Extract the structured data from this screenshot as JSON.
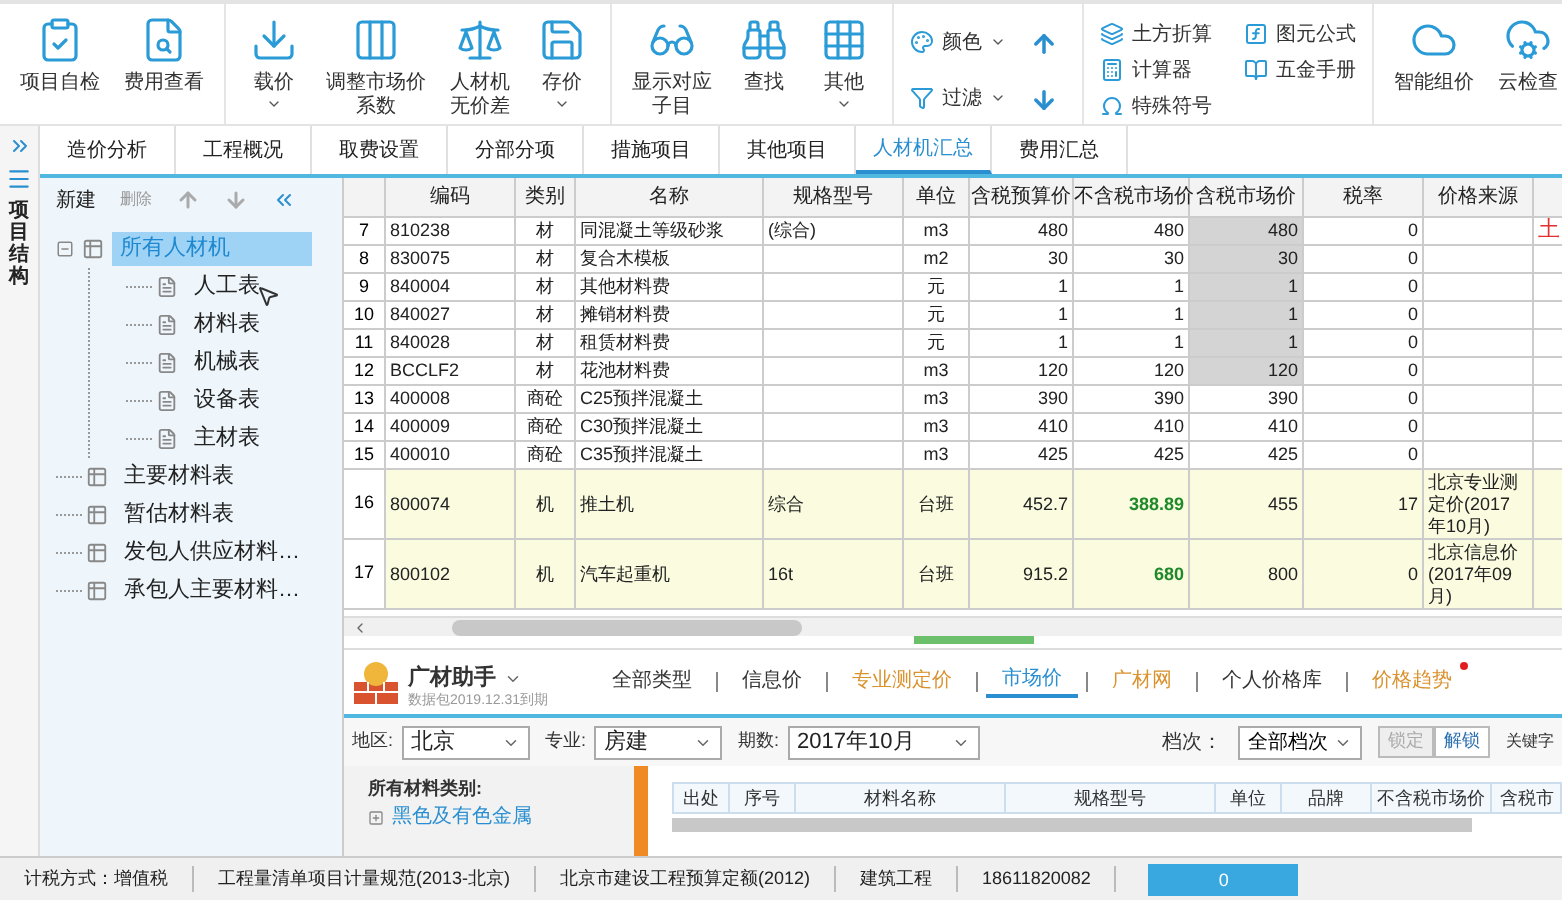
{
  "toolbar": {
    "groups": [
      {
        "kind": "big",
        "items": [
          {
            "lines": [
              "项目自检"
            ],
            "dropdown": false
          },
          {
            "lines": [
              "费用查看"
            ],
            "dropdown": false
          }
        ]
      },
      {
        "kind": "big",
        "items": [
          {
            "lines": [
              "载价"
            ],
            "dropdown": true
          },
          {
            "lines": [
              "调整市场价",
              "系数"
            ],
            "dropdown": false
          },
          {
            "lines": [
              "人材机",
              "无价差"
            ],
            "dropdown": false
          },
          {
            "lines": [
              "存价"
            ],
            "dropdown": true
          }
        ]
      },
      {
        "kind": "big",
        "items": [
          {
            "lines": [
              "显示对应",
              "子目"
            ],
            "dropdown": false
          },
          {
            "lines": [
              "查找"
            ],
            "dropdown": false
          },
          {
            "lines": [
              "其他"
            ],
            "dropdown": true
          }
        ]
      },
      {
        "kind": "compact",
        "items": [
          {
            "kind": "text",
            "label": "颜色",
            "dropdown": true
          },
          {
            "kind": "text",
            "label": "过滤",
            "dropdown": true
          },
          {
            "kind": "arrow-up"
          },
          {
            "kind": "arrow-down"
          }
        ]
      },
      {
        "kind": "list",
        "items": [
          {
            "kind": "text",
            "label": "土方折算",
            "dropdown": false
          },
          {
            "kind": "text",
            "label": "计算器",
            "dropdown": false
          },
          {
            "kind": "text",
            "label": "特殊符号",
            "dropdown": false
          },
          {
            "kind": "text",
            "label": "图元公式",
            "dropdown": false
          },
          {
            "kind": "text",
            "label": "五金手册",
            "dropdown": false
          }
        ]
      },
      {
        "kind": "big",
        "items": [
          {
            "lines": [
              "智能组价"
            ],
            "dropdown": false
          },
          {
            "lines": [
              "云检查"
            ],
            "dropdown": false
          }
        ]
      }
    ]
  },
  "side_strip": {
    "label": "项目结构"
  },
  "tabs": [
    {
      "label": "造价分析",
      "selected": false
    },
    {
      "label": "工程概况",
      "selected": false
    },
    {
      "label": "取费设置",
      "selected": false
    },
    {
      "label": "分部分项",
      "selected": false
    },
    {
      "label": "措施项目",
      "selected": false
    },
    {
      "label": "其他项目",
      "selected": false
    },
    {
      "label": "人材机汇总",
      "selected": true
    },
    {
      "label": "费用汇总",
      "selected": false
    }
  ],
  "tree_toolbar": {
    "new": "新建",
    "delete": "删除",
    "delete_disabled": true
  },
  "tree": [
    {
      "label": "所有人材机",
      "kind": "group",
      "selected": true,
      "expanded": true,
      "children": [
        {
          "label": "人工表",
          "kind": "sheet",
          "selected": false
        },
        {
          "label": "材料表",
          "kind": "sheet",
          "selected": false
        },
        {
          "label": "机械表",
          "kind": "sheet",
          "selected": false
        },
        {
          "label": "设备表",
          "kind": "sheet",
          "selected": false
        },
        {
          "label": "主材表",
          "kind": "sheet",
          "selected": false
        }
      ]
    },
    {
      "label": "主要材料表",
      "kind": "group",
      "selected": false
    },
    {
      "label": "暂估材料表",
      "kind": "group",
      "selected": false
    },
    {
      "label": "发包人供应材料…",
      "kind": "group",
      "selected": false
    },
    {
      "label": "承包人主要材料…",
      "kind": "group",
      "selected": false
    }
  ],
  "table": {
    "columns": [
      "编码",
      "类别",
      "名称",
      "规格型号",
      "单位",
      "含税预算价",
      "不含税市场价",
      "含税市场价",
      "税率",
      "价格来源"
    ],
    "rows": [
      {
        "no": "7",
        "cells": [
          "810238",
          "材",
          "同混凝土等级砂浆",
          "(综合)",
          "m3",
          "480",
          "480",
          "480",
          "0",
          ""
        ],
        "shaded": true,
        "highlighted": false,
        "note": "土"
      },
      {
        "no": "8",
        "cells": [
          "830075",
          "材",
          "复合木模板",
          "",
          "m2",
          "30",
          "30",
          "30",
          "0",
          ""
        ],
        "shaded": true,
        "highlighted": false
      },
      {
        "no": "9",
        "cells": [
          "840004",
          "材",
          "其他材料费",
          "",
          "元",
          "1",
          "1",
          "1",
          "0",
          ""
        ],
        "shaded": true,
        "highlighted": false
      },
      {
        "no": "10",
        "cells": [
          "840027",
          "材",
          "摊销材料费",
          "",
          "元",
          "1",
          "1",
          "1",
          "0",
          ""
        ],
        "shaded": true,
        "highlighted": false
      },
      {
        "no": "11",
        "cells": [
          "840028",
          "材",
          "租赁材料费",
          "",
          "元",
          "1",
          "1",
          "1",
          "0",
          ""
        ],
        "shaded": true,
        "highlighted": false
      },
      {
        "no": "12",
        "cells": [
          "BCCLF2",
          "材",
          "花池材料费",
          "",
          "m3",
          "120",
          "120",
          "120",
          "0",
          ""
        ],
        "shaded": true,
        "highlighted": false
      },
      {
        "no": "13",
        "cells": [
          "400008",
          "商砼",
          "C25预拌混凝土",
          "",
          "m3",
          "390",
          "390",
          "390",
          "0",
          ""
        ],
        "shaded": false,
        "highlighted": false
      },
      {
        "no": "14",
        "cells": [
          "400009",
          "商砼",
          "C30预拌混凝土",
          "",
          "m3",
          "410",
          "410",
          "410",
          "0",
          ""
        ],
        "shaded": false,
        "highlighted": false
      },
      {
        "no": "15",
        "cells": [
          "400010",
          "商砼",
          "C35预拌混凝土",
          "",
          "m3",
          "425",
          "425",
          "425",
          "0",
          ""
        ],
        "shaded": false,
        "highlighted": false
      },
      {
        "no": "16",
        "cells": [
          "800074",
          "机",
          "推土机",
          "综合",
          "台班",
          "452.7",
          "388.89",
          "455",
          "17",
          "北京专业测定价(2017年10月)"
        ],
        "shaded": false,
        "highlighted": true
      },
      {
        "no": "17",
        "cells": [
          "800102",
          "机",
          "汽车起重机",
          "16t",
          "台班",
          "915.2",
          "680",
          "800",
          "0",
          "北京信息价(2017年09月)"
        ],
        "shaded": false,
        "highlighted": true
      }
    ]
  },
  "assistant": {
    "title": "广材助手",
    "subtitle": "数据包2019.12.31到期",
    "tabs": [
      {
        "label": "全部类型",
        "selected": false,
        "color": "#333333",
        "badge": false
      },
      {
        "label": "信息价",
        "selected": false,
        "color": "#333333",
        "badge": false
      },
      {
        "label": "专业测定价",
        "selected": false,
        "color": "#d9922e",
        "badge": false
      },
      {
        "label": "市场价",
        "selected": true,
        "color": "#2a8fd0",
        "badge": false
      },
      {
        "label": "广材网",
        "selected": false,
        "color": "#d9922e",
        "badge": false
      },
      {
        "label": "个人价格库",
        "selected": false,
        "color": "#333333",
        "badge": false
      },
      {
        "label": "价格趋势",
        "selected": false,
        "color": "#d9922e",
        "badge": true
      }
    ],
    "filters": [
      {
        "label": "地区:",
        "value": "北京"
      },
      {
        "label": "专业:",
        "value": "房建"
      },
      {
        "label": "期数:",
        "value": "2017年10月"
      }
    ],
    "grade": {
      "label": "档次：",
      "value": "全部档次"
    },
    "lock": {
      "label": "锁定",
      "disabled": true
    },
    "unlock": {
      "label": "解锁",
      "disabled": false
    },
    "keyword": "关键字",
    "category_title": "所有材料类别:",
    "categories": [
      {
        "label": "黑色及有色金属",
        "expanded": false
      }
    ],
    "columns": [
      "出处",
      "序号",
      "材料名称",
      "规格型号",
      "单位",
      "品牌",
      "不含税市场价",
      "含税市"
    ]
  },
  "status_bar": [
    "计税方式：增值税",
    "工程量清单项目计量规范(2013-北京)",
    "北京市建设工程预算定额(2012)",
    "建筑工程",
    "18611820082"
  ],
  "status_value": "0"
}
